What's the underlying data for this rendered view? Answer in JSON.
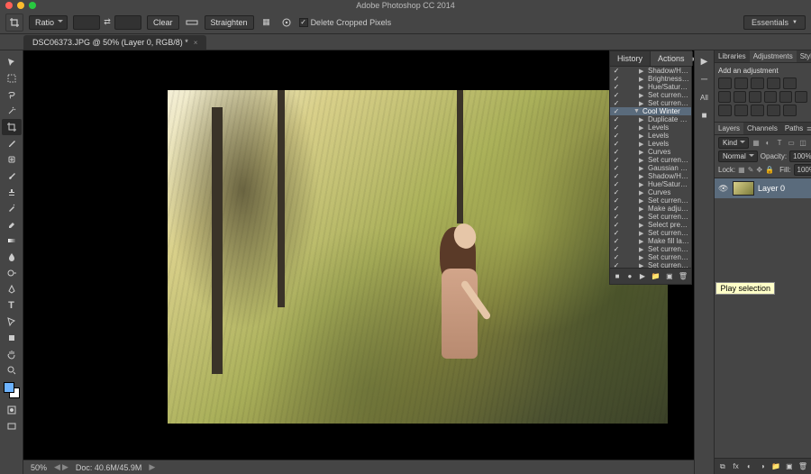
{
  "app": {
    "title": "Adobe Photoshop CC 2014"
  },
  "workspace": {
    "label": "Essentials"
  },
  "options": {
    "ratio_label": "Ratio",
    "clear_btn": "Clear",
    "straighten_btn": "Straighten",
    "delete_cropped_label": "Delete Cropped Pixels"
  },
  "document": {
    "tab_label": "DSC06373.JPG @ 50% (Layer 0, RGB/8) *",
    "zoom": "50%",
    "doc_size": "Doc: 40.6M/45.9M"
  },
  "tools": [
    "move",
    "marquee",
    "lasso",
    "wand",
    "crop",
    "eyedrop",
    "patch",
    "brush",
    "stamp",
    "history",
    "eraser",
    "gradient",
    "blur",
    "dodge",
    "pen",
    "type",
    "path",
    "rect",
    "hand",
    "zoom"
  ],
  "actionsPanel": {
    "tabs": {
      "history": "History",
      "actions": "Actions"
    },
    "pre_items": [
      "Shadow/Highlight",
      "Brightness/Cont...",
      "Hue/Saturation",
      "Set current layer",
      "Set current layer"
    ],
    "set_name": "Cool Winter",
    "items": [
      "Duplicate current...",
      "Levels",
      "Levels",
      "Levels",
      "Curves",
      "Set current layer",
      "Gaussian Blur",
      "Shadow/Highlight",
      "Hue/Saturation",
      "Curves",
      "Set current layer",
      "Make adjustment...",
      "Set current adjust...",
      "Select previous h...",
      "Set current adjust...",
      "Make fill layer",
      "Set current layer",
      "Set current layer",
      "Set current layer"
    ],
    "tooltip": "Play selection",
    "iconbar_label": "All"
  },
  "adjustments": {
    "tabs": {
      "libraries": "Libraries",
      "adjustments": "Adjustments",
      "styles": "Styles"
    },
    "title": "Add an adjustment"
  },
  "layers": {
    "tabs": {
      "layers": "Layers",
      "channels": "Channels",
      "paths": "Paths"
    },
    "kind_label": "Kind",
    "blend_mode": "Normal",
    "opacity_label": "Opacity:",
    "opacity_val": "100%",
    "lock_label": "Lock:",
    "fill_label": "Fill:",
    "fill_val": "100%",
    "layer0": "Layer 0"
  }
}
